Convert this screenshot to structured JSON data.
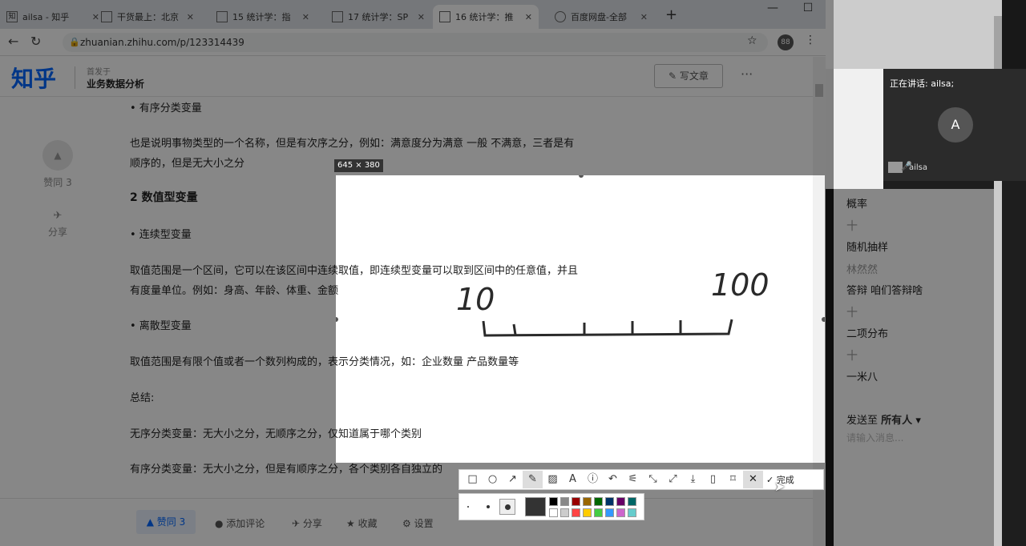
{
  "browser": {
    "tabs": [
      {
        "label": "ailsa - 知乎",
        "icon": "zhihu-icon"
      },
      {
        "label": "干货最上：北京",
        "icon": "page-icon"
      },
      {
        "label": "15 统计学：指",
        "icon": "page-icon"
      },
      {
        "label": "17 统计学：SP",
        "icon": "page-icon"
      },
      {
        "label": "16 统计学：推",
        "icon": "page-icon"
      },
      {
        "label": "百度网盘-全部",
        "icon": "cloud-icon"
      }
    ],
    "url": "zhuanian.zhihu.com/p/123314439",
    "profile": "88"
  },
  "header": {
    "logo": "知乎",
    "published_in": "首发于",
    "column": "业务数据分析",
    "write_button": "写文章"
  },
  "side": {
    "agree": "赞同 3",
    "share": "分享"
  },
  "article": {
    "lines": [
      {
        "text": "•  有序分类变量",
        "cls": ""
      },
      {
        "text": "也是说明事物类型的一个名称，但是有次序之分，例如：满意度分为满意 一般 不满意，三者是有",
        "cls": ""
      },
      {
        "text": "顺序的，但是无大小之分",
        "cls": ""
      },
      {
        "text": "2 数值型变量",
        "cls": "h2"
      },
      {
        "text": "•  连续型变量",
        "cls": ""
      },
      {
        "text": "取值范围是一个区间，它可以在该区间中连续取值，即连续型变量可以取到区间中的任意值，并且",
        "cls": ""
      },
      {
        "text": "有度量单位。例如：身高、年龄、体重、金额",
        "cls": ""
      },
      {
        "text": "•  离散型变量",
        "cls": ""
      },
      {
        "text": "取值范围是有限个值或者一个数列构成的，表示分类情况，如：企业数量 产品数量等",
        "cls": ""
      },
      {
        "text": "总结:",
        "cls": ""
      },
      {
        "text": "无序分类变量：无大小之分，无顺序之分，仅知道属于哪个类别",
        "cls": ""
      },
      {
        "text": "有序分类变量：无大小之分，但是有顺序之分，各个类别各自独立的",
        "cls": ""
      }
    ]
  },
  "bottom": {
    "agree": "▲ 赞同 3",
    "comment": "添加评论",
    "share": "分享",
    "favorite": "收藏",
    "settings": "设置"
  },
  "screenshot": {
    "size_label": "645 × 380",
    "annotation_left": "10",
    "annotation_right": "100",
    "done_label": "完成"
  },
  "meeting": {
    "speaking": "正在讲话: ailsa;",
    "avatar_letter": "A",
    "video_name": "ailsa"
  },
  "chat": {
    "messages": [
      {
        "text": "概率",
        "cls": ""
      },
      {
        "text": "十",
        "cls": "sep"
      },
      {
        "text": "随机抽样",
        "cls": ""
      },
      {
        "text": "林然然",
        "cls": "gray"
      },
      {
        "text": "答辩 咱们答辩啥",
        "cls": ""
      },
      {
        "text": "十",
        "cls": "sep"
      },
      {
        "text": "二项分布",
        "cls": ""
      },
      {
        "text": "十",
        "cls": "sep"
      },
      {
        "text": "一米八",
        "cls": ""
      }
    ],
    "send_to_label": "发送至",
    "send_to_target": "所有人",
    "input_placeholder": "请输入消息..."
  },
  "colors": {
    "accent": "#0066ff",
    "dim": "rgba(0,0,0,0.47)"
  }
}
